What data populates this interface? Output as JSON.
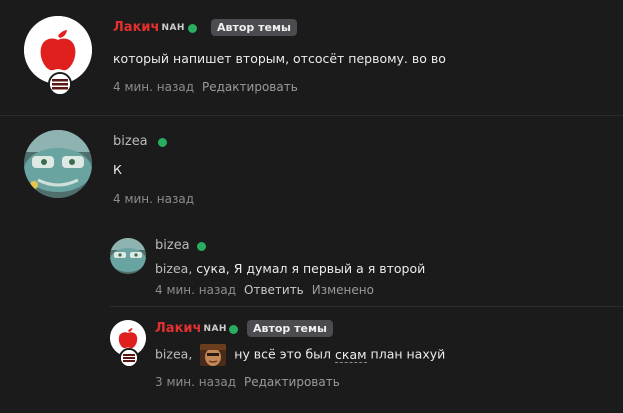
{
  "posts": [
    {
      "author": "Лакич",
      "author_tag": "NAH",
      "badge": "Автор темы",
      "text": "который напишет вторым, отсосёт первому. во во",
      "time": "4 мин. назад",
      "action": "Редактировать"
    },
    {
      "author": "bizea",
      "text": "К",
      "time": "4 мин. назад"
    }
  ],
  "replies": [
    {
      "author": "bizea",
      "mention": "bizea,",
      "text": "сука, Я думал я первый а я второй",
      "time": "4 мин. назад",
      "action_reply": "Ответить",
      "action_edited": "Изменено"
    },
    {
      "author": "Лакич",
      "author_tag": "NAH",
      "badge": "Автор темы",
      "mention": "bizea,",
      "text_before": "ну всё это был",
      "text_dashed": "скам",
      "text_after": "план нахуй",
      "time": "3 мин. назад",
      "action": "Редактировать"
    }
  ],
  "colors": {
    "background": "#1b1b1c",
    "author_red": "#e0312f",
    "online": "#27ae60",
    "badge_bg": "#4b4b50"
  },
  "icons": {
    "apple_avatar": "apple-logo-icon",
    "car_avatar": "bus-car-avatar",
    "striped_badge": "striped-badge-icon"
  }
}
